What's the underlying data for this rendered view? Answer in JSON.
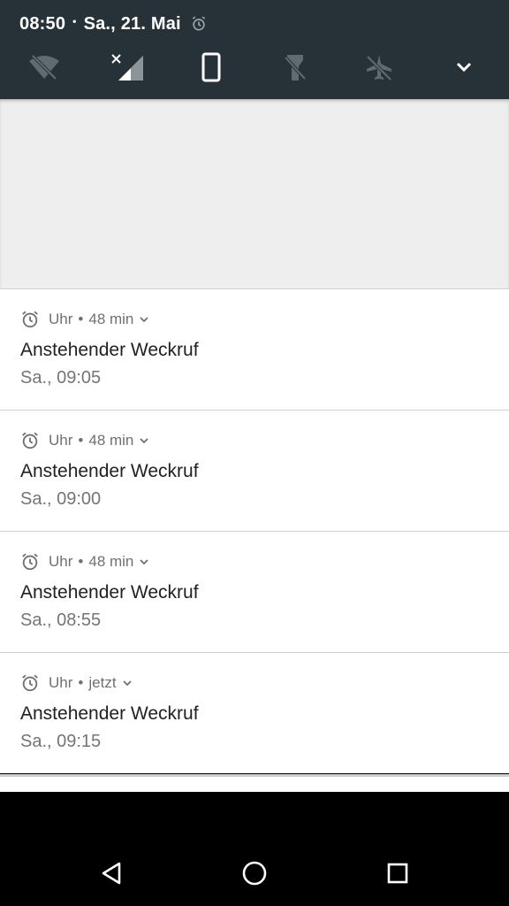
{
  "status_bar": {
    "time": "08:50",
    "separator": "•",
    "date": "Sa., 21. Mai",
    "alarm_icon": "alarm-icon"
  },
  "quick_settings": [
    {
      "name": "wifi-off",
      "icon": "wifi-off-icon",
      "active": false
    },
    {
      "name": "mobile-data",
      "icon": "cell-signal-icon",
      "active": true
    },
    {
      "name": "auto-rotate",
      "icon": "phone-portrait-icon",
      "active": true
    },
    {
      "name": "flashlight",
      "icon": "flashlight-off-icon",
      "active": false
    },
    {
      "name": "airplane-mode",
      "icon": "airplane-off-icon",
      "active": false
    },
    {
      "name": "expand",
      "icon": "chevron-down-icon",
      "active": true
    }
  ],
  "notifications": [
    {
      "app": "Uhr",
      "dot": "•",
      "time": "48 min",
      "title": "Anstehender Weckruf",
      "subtitle": "Sa., 09:05"
    },
    {
      "app": "Uhr",
      "dot": "•",
      "time": "48 min",
      "title": "Anstehender Weckruf",
      "subtitle": "Sa., 09:00"
    },
    {
      "app": "Uhr",
      "dot": "•",
      "time": "48 min",
      "title": "Anstehender Weckruf",
      "subtitle": "Sa., 08:55"
    },
    {
      "app": "Uhr",
      "dot": "•",
      "time": "jetzt",
      "title": "Anstehender Weckruf",
      "subtitle": "Sa., 09:15"
    }
  ],
  "navigation": {
    "back": "back-triangle-icon",
    "home": "home-circle-icon",
    "recents": "recents-square-icon"
  },
  "colors": {
    "header_bg": "#263238",
    "empty_area_bg": "#eeeeee",
    "notification_bg": "#ffffff",
    "navbar_bg": "#000000"
  }
}
